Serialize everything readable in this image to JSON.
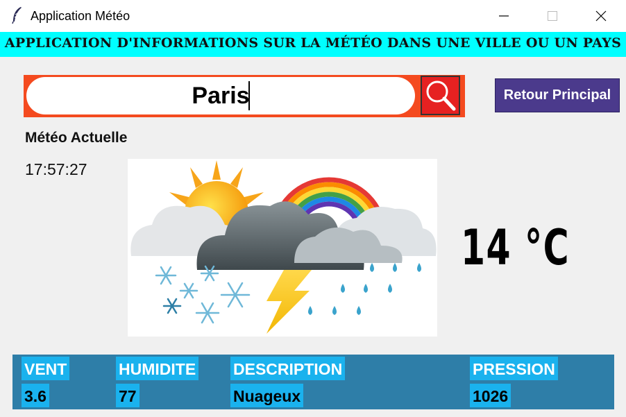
{
  "window": {
    "title": "Application Météo",
    "controls": {
      "minimize": "—",
      "maximize": "☐",
      "close": "✕"
    }
  },
  "banner": {
    "text": "APPLICATION D'INFORMATIONS SUR LA MÉTÉO DANS UNE VILLE OU UN PAYS",
    "color": "#00ffff"
  },
  "search": {
    "value": "Paris",
    "button_icon": "magnifier-icon"
  },
  "retour_button": "Retour Principal",
  "meteo": {
    "title": "Météo Actuelle",
    "time": "17:57:27",
    "image_icon": "weather-sun-cloud-rainbow-snow-lightning-rain-icon",
    "temperature": "14 °C"
  },
  "info": {
    "headers": {
      "wind": "VENT",
      "humidity": "HUMIDITE",
      "description": "DESCRIPTION",
      "pressure": "PRESSION"
    },
    "values": {
      "wind": "3.6",
      "humidity": "77",
      "description": "Nuageux",
      "pressure": "1026"
    }
  },
  "colors": {
    "search_frame": "#f44a1f",
    "search_button": "#e62121",
    "retour_button": "#4b3a8c",
    "info_panel": "#2e7ea8",
    "info_cell": "#1ab2ee"
  }
}
